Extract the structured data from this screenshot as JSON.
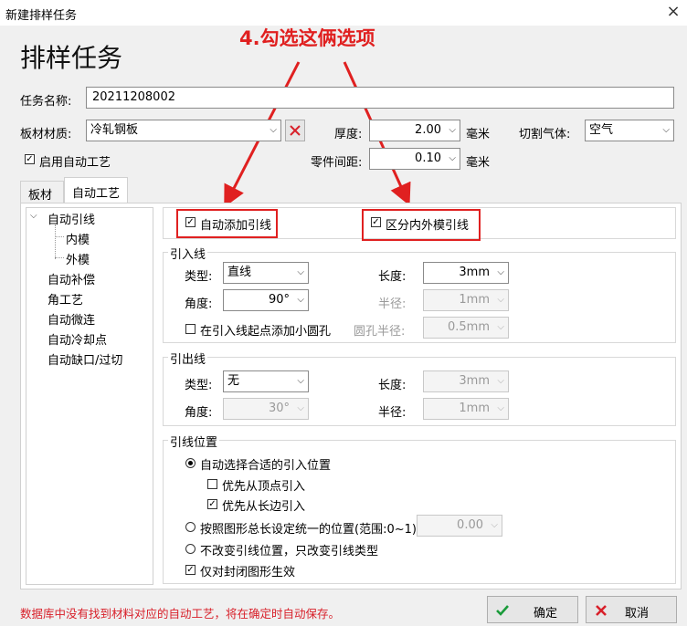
{
  "window": {
    "title": "新建排样任务",
    "close": "×"
  },
  "heading": "排样任务",
  "annotation": "4.勾选这俩选项",
  "task": {
    "label": "任务名称:",
    "value": "20211208002"
  },
  "material": {
    "label": "板材材质:",
    "value": "冷轧钢板"
  },
  "thickness": {
    "label": "厚度:",
    "value": "2.00",
    "unit": "毫米"
  },
  "gas": {
    "label": "切割气体:",
    "value": "空气"
  },
  "enable_auto": {
    "label": "启用自动工艺",
    "checked": true
  },
  "part_gap": {
    "label": "零件间距:",
    "value": "0.10",
    "unit": "毫米"
  },
  "tabs": [
    {
      "label": "板材"
    },
    {
      "label": "自动工艺"
    }
  ],
  "tree": {
    "items": [
      {
        "label": "自动引线"
      },
      {
        "label": "内模"
      },
      {
        "label": "外模"
      },
      {
        "label": "自动补偿"
      },
      {
        "label": "角工艺"
      },
      {
        "label": "自动微连"
      },
      {
        "label": "自动冷却点"
      },
      {
        "label": "自动缺口/过切"
      }
    ]
  },
  "auto_lead": {
    "label": "自动添加引线",
    "checked": true
  },
  "split_lead": {
    "label": "区分内外模引线",
    "checked": true
  },
  "lead_in": {
    "title": "引入线",
    "type_label": "类型:",
    "type_value": "直线",
    "length_label": "长度:",
    "length_value": "3mm",
    "angle_label": "角度:",
    "angle_value": "90°",
    "radius_label": "半径:",
    "radius_value": "1mm",
    "circle_label": "在引入线起点添加小圆孔",
    "hole_radius_label": "圆孔半径:",
    "hole_radius_value": "0.5mm"
  },
  "lead_out": {
    "title": "引出线",
    "type_label": "类型:",
    "type_value": "无",
    "length_label": "长度:",
    "length_value": "3mm",
    "angle_label": "角度:",
    "angle_value": "30°",
    "radius_label": "半径:",
    "radius_value": "1mm"
  },
  "lead_pos": {
    "title": "引线位置",
    "auto_label": "自动选择合适的引入位置",
    "vertex_label": "优先从顶点引入",
    "long_edge_label": "优先从长边引入",
    "by_length_label": "按照图形总长设定统一的位置(范围:0~1)",
    "by_length_value": "0.00",
    "no_change_label": "不改变引线位置，只改变引线类型",
    "closed_only_label": "仅对封闭图形生效"
  },
  "footer": {
    "message": "数据库中没有找到材料对应的自动工艺，将在确定时自动保存。",
    "ok": "确定",
    "cancel": "取消"
  },
  "colors": {
    "accent_red": "#e02020",
    "ok_green": "#1a9b3a",
    "cancel_red": "#d8202a"
  }
}
